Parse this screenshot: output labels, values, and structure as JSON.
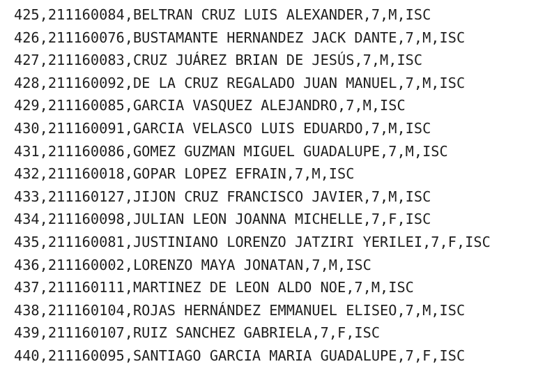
{
  "document": {
    "lines": [
      "425,211160084,BELTRAN CRUZ LUIS ALEXANDER,7,M,ISC",
      "426,211160076,BUSTAMANTE HERNANDEZ JACK DANTE,7,M,ISC",
      "427,211160083,CRUZ JUÁREZ BRIAN DE JESÚS,7,M,ISC",
      "428,211160092,DE LA CRUZ REGALADO JUAN MANUEL,7,M,ISC",
      "429,211160085,GARCIA VASQUEZ ALEJANDRO,7,M,ISC",
      "430,211160091,GARCIA VELASCO LUIS EDUARDO,7,M,ISC",
      "431,211160086,GOMEZ GUZMAN MIGUEL GUADALUPE,7,M,ISC",
      "432,211160018,GOPAR LOPEZ EFRAIN,7,M,ISC",
      "433,211160127,JIJON CRUZ FRANCISCO JAVIER,7,M,ISC",
      "434,211160098,JULIAN LEON JOANNA MICHELLE,7,F,ISC",
      "435,211160081,JUSTINIANO LORENZO JATZIRI YERILEI,7,F,ISC",
      "436,211160002,LORENZO MAYA JONATAN,7,M,ISC",
      "437,211160111,MARTINEZ DE LEON ALDO NOE,7,M,ISC",
      "438,211160104,ROJAS HERNÁNDEZ EMMANUEL ELISEO,7,M,ISC",
      "439,211160107,RUIZ SANCHEZ GABRIELA,7,F,ISC",
      "440,211160095,SANTIAGO GARCIA MARIA GUADALUPE,7,F,ISC"
    ]
  }
}
